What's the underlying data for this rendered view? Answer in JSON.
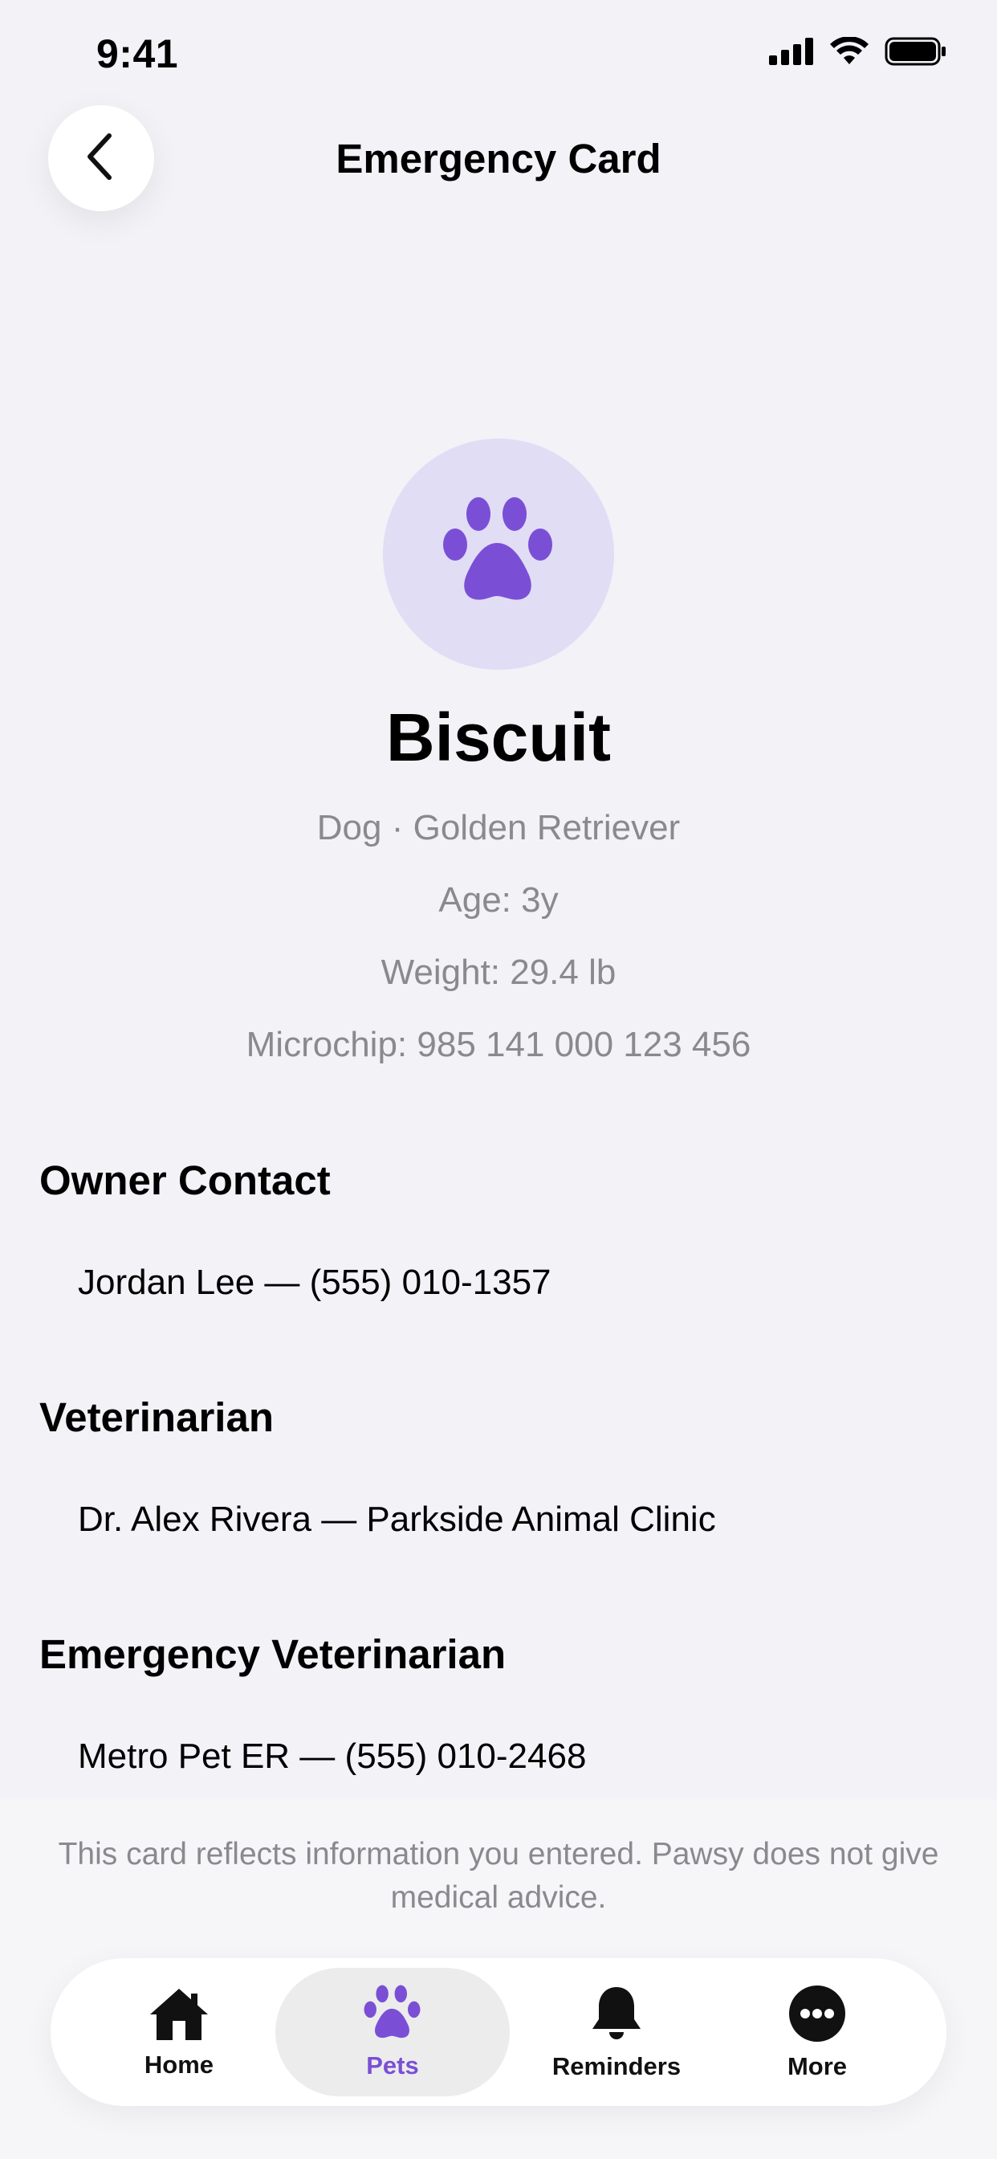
{
  "status_bar": {
    "time": "9:41"
  },
  "header": {
    "title": "Emergency Card"
  },
  "pet": {
    "name": "Biscuit",
    "species_breed": "Dog · Golden Retriever",
    "age": "Age: 3y",
    "weight": "Weight: 29.4 lb",
    "microchip": "Microchip: 985 141 000 123 456"
  },
  "sections": [
    {
      "title": "Owner Contact",
      "value": "Jordan Lee — (555) 010-1357"
    },
    {
      "title": "Veterinarian",
      "value": "Dr. Alex Rivera — Parkside Animal Clinic"
    },
    {
      "title": "Emergency Veterinarian",
      "value": "Metro Pet ER — (555) 010-2468"
    }
  ],
  "disclaimer": "This card reflects information you entered. Pawsy does not give medical advice.",
  "tabs": [
    {
      "label": "Home",
      "icon": "house-icon"
    },
    {
      "label": "Pets",
      "icon": "paw-icon",
      "active": true
    },
    {
      "label": "Reminders",
      "icon": "bell-icon"
    },
    {
      "label": "More",
      "icon": "ellipsis-circle-icon"
    }
  ],
  "colors": {
    "accent": "#7a4fd6",
    "avatar_bg": "#e1ddf5",
    "background": "#f2f2f7"
  }
}
